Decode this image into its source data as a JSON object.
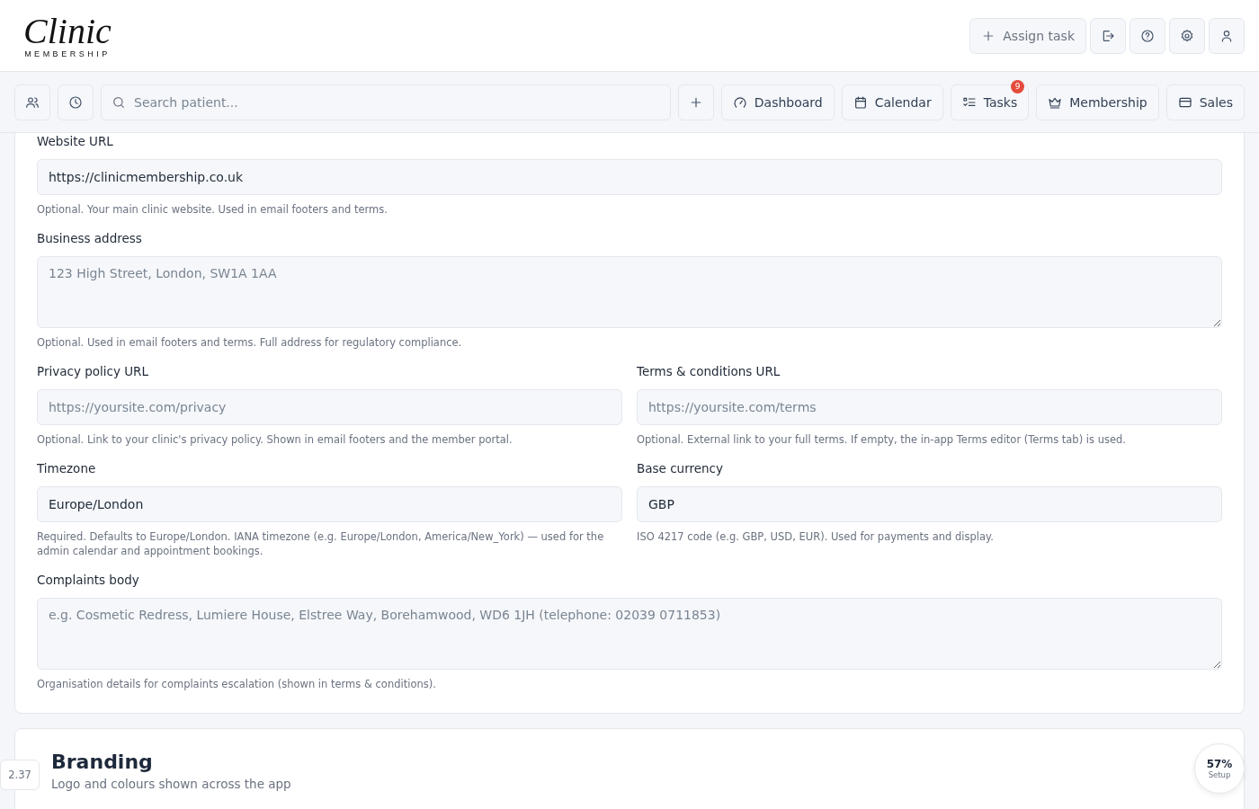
{
  "logo": {
    "script": "Clinic",
    "subtitle": "MEMBERSHIP"
  },
  "top_actions": [
    {
      "kind": "text",
      "label": "Assign task"
    },
    {
      "kind": "icon"
    },
    {
      "kind": "icon"
    },
    {
      "kind": "icon"
    },
    {
      "kind": "icon"
    }
  ],
  "nav": {
    "search": {
      "placeholder": "Search patient..."
    },
    "items": [
      {
        "label": "Dashboard"
      },
      {
        "label": "Calendar"
      },
      {
        "label": "Tasks",
        "badge": "9"
      },
      {
        "label": "Membership"
      },
      {
        "label": "Sales"
      }
    ]
  },
  "settings_rows": [
    [
      {
        "kind": "input",
        "label": "Website URL",
        "value": "https://clinicmembership.co.uk",
        "help": "Optional. Your main clinic website. Used in email footers and terms."
      }
    ],
    [
      {
        "kind": "textarea",
        "label": "Business address",
        "placeholder": "123 High Street, London, SW1A 1AA",
        "help": "Optional. Used in email footers and terms. Full address for regulatory compliance."
      }
    ],
    [
      {
        "kind": "input",
        "label": "Privacy policy URL",
        "placeholder": "https://yoursite.com/privacy",
        "help": "Optional. Link to your clinic's privacy policy. Shown in email footers and the member portal."
      },
      {
        "kind": "input",
        "label": "Terms & conditions URL",
        "placeholder": "https://yoursite.com/terms",
        "help": "Optional. External link to your full terms. If empty, the in-app Terms editor (Terms tab) is used."
      }
    ],
    [
      {
        "kind": "input",
        "label": "Timezone",
        "value": "Europe/London",
        "help": "Required. Defaults to Europe/London. IANA timezone (e.g. Europe/London, America/New_York) — used for the admin calendar and appointment bookings."
      },
      {
        "kind": "input",
        "label": "Base currency",
        "value": "GBP",
        "help": "ISO 4217 code (e.g. GBP, USD, EUR). Used for payments and display."
      }
    ],
    [
      {
        "kind": "textarea",
        "label": "Complaints body",
        "placeholder": "e.g. Cosmetic Redress, Lumiere House, Elstree Way, Borehamwood, WD6 1JH (telephone: 02039 0711853)",
        "help": "Organisation details for complaints escalation (shown in terms & conditions)."
      }
    ]
  ],
  "branding": {
    "title": "Branding",
    "subtitle": "Logo and colours shown across the app"
  },
  "version": "2.37",
  "setup": {
    "percent": "57%",
    "label": "Setup"
  }
}
